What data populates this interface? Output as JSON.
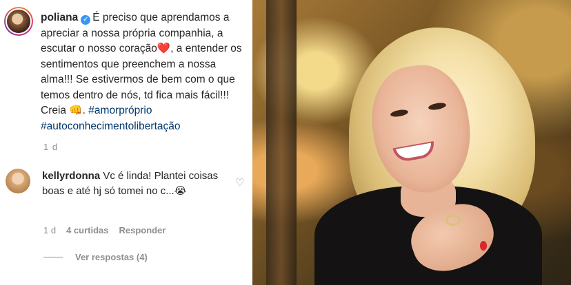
{
  "post": {
    "username": "poliana",
    "verified_icon": "verified-badge-icon",
    "caption_parts": [
      "É preciso que aprendamos a apreciar a nossa própria companhia, a escutar o nosso coração",
      "❤️",
      ", a entender os sentimentos que preenchem a nossa alma!!! Se estivermos de bem com o que temos dentro de nós, td fica mais fácil!!! Creia ",
      "👊",
      ". "
    ],
    "hashtags": [
      "#amorpróprio",
      "#autoconhecimentolibertação"
    ],
    "time": "1 d"
  },
  "comment": {
    "username": "kellyrdonna",
    "text": "Vc é linda! Plantei coisas boas e até hj só tomei no c...",
    "emoji": "😭",
    "time": "1 d",
    "likes": "4 curtidas",
    "reply_label": "Responder",
    "view_replies": "Ver respostas (4)",
    "like_icon": "heart-outline-icon"
  },
  "colors": {
    "text": "#262626",
    "muted": "#8e8e8e",
    "hashtag": "#00376b",
    "verified": "#3897f0"
  }
}
